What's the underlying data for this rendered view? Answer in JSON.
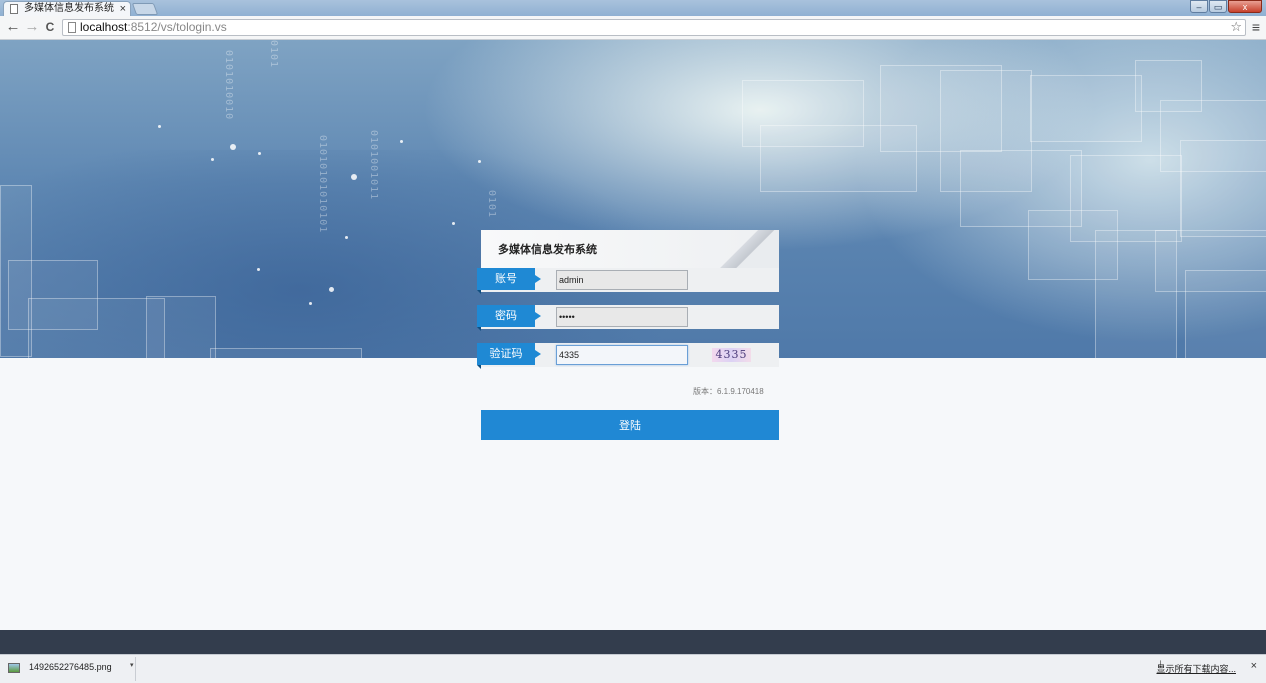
{
  "browser": {
    "tab_title": "多媒体信息发布系统",
    "tab_close": "×",
    "url_host": "localhost",
    "url_path": ":8512/vs/tologin.vs",
    "back": "←",
    "forward": "→",
    "reload": "C",
    "star": "☆",
    "menu": "≡",
    "window_controls": {
      "minimize": "–",
      "restore": "▭",
      "close": "x"
    }
  },
  "login": {
    "title": "多媒体信息发布系统",
    "account_label": "账号",
    "account_value": "admin",
    "password_label": "密码",
    "password_value": "•••••",
    "captcha_label": "验证码",
    "captcha_value": "4335",
    "captcha_image_text": "4335",
    "version": "版本：6.1.9.170418",
    "submit_label": "登陆"
  },
  "download_shelf": {
    "file_name": "1492652276485.png",
    "dropdown": "▾",
    "show_all": "显示所有下载内容...",
    "close": "×"
  },
  "colors": {
    "accent": "#2088d4",
    "footer": "#333d4d"
  }
}
